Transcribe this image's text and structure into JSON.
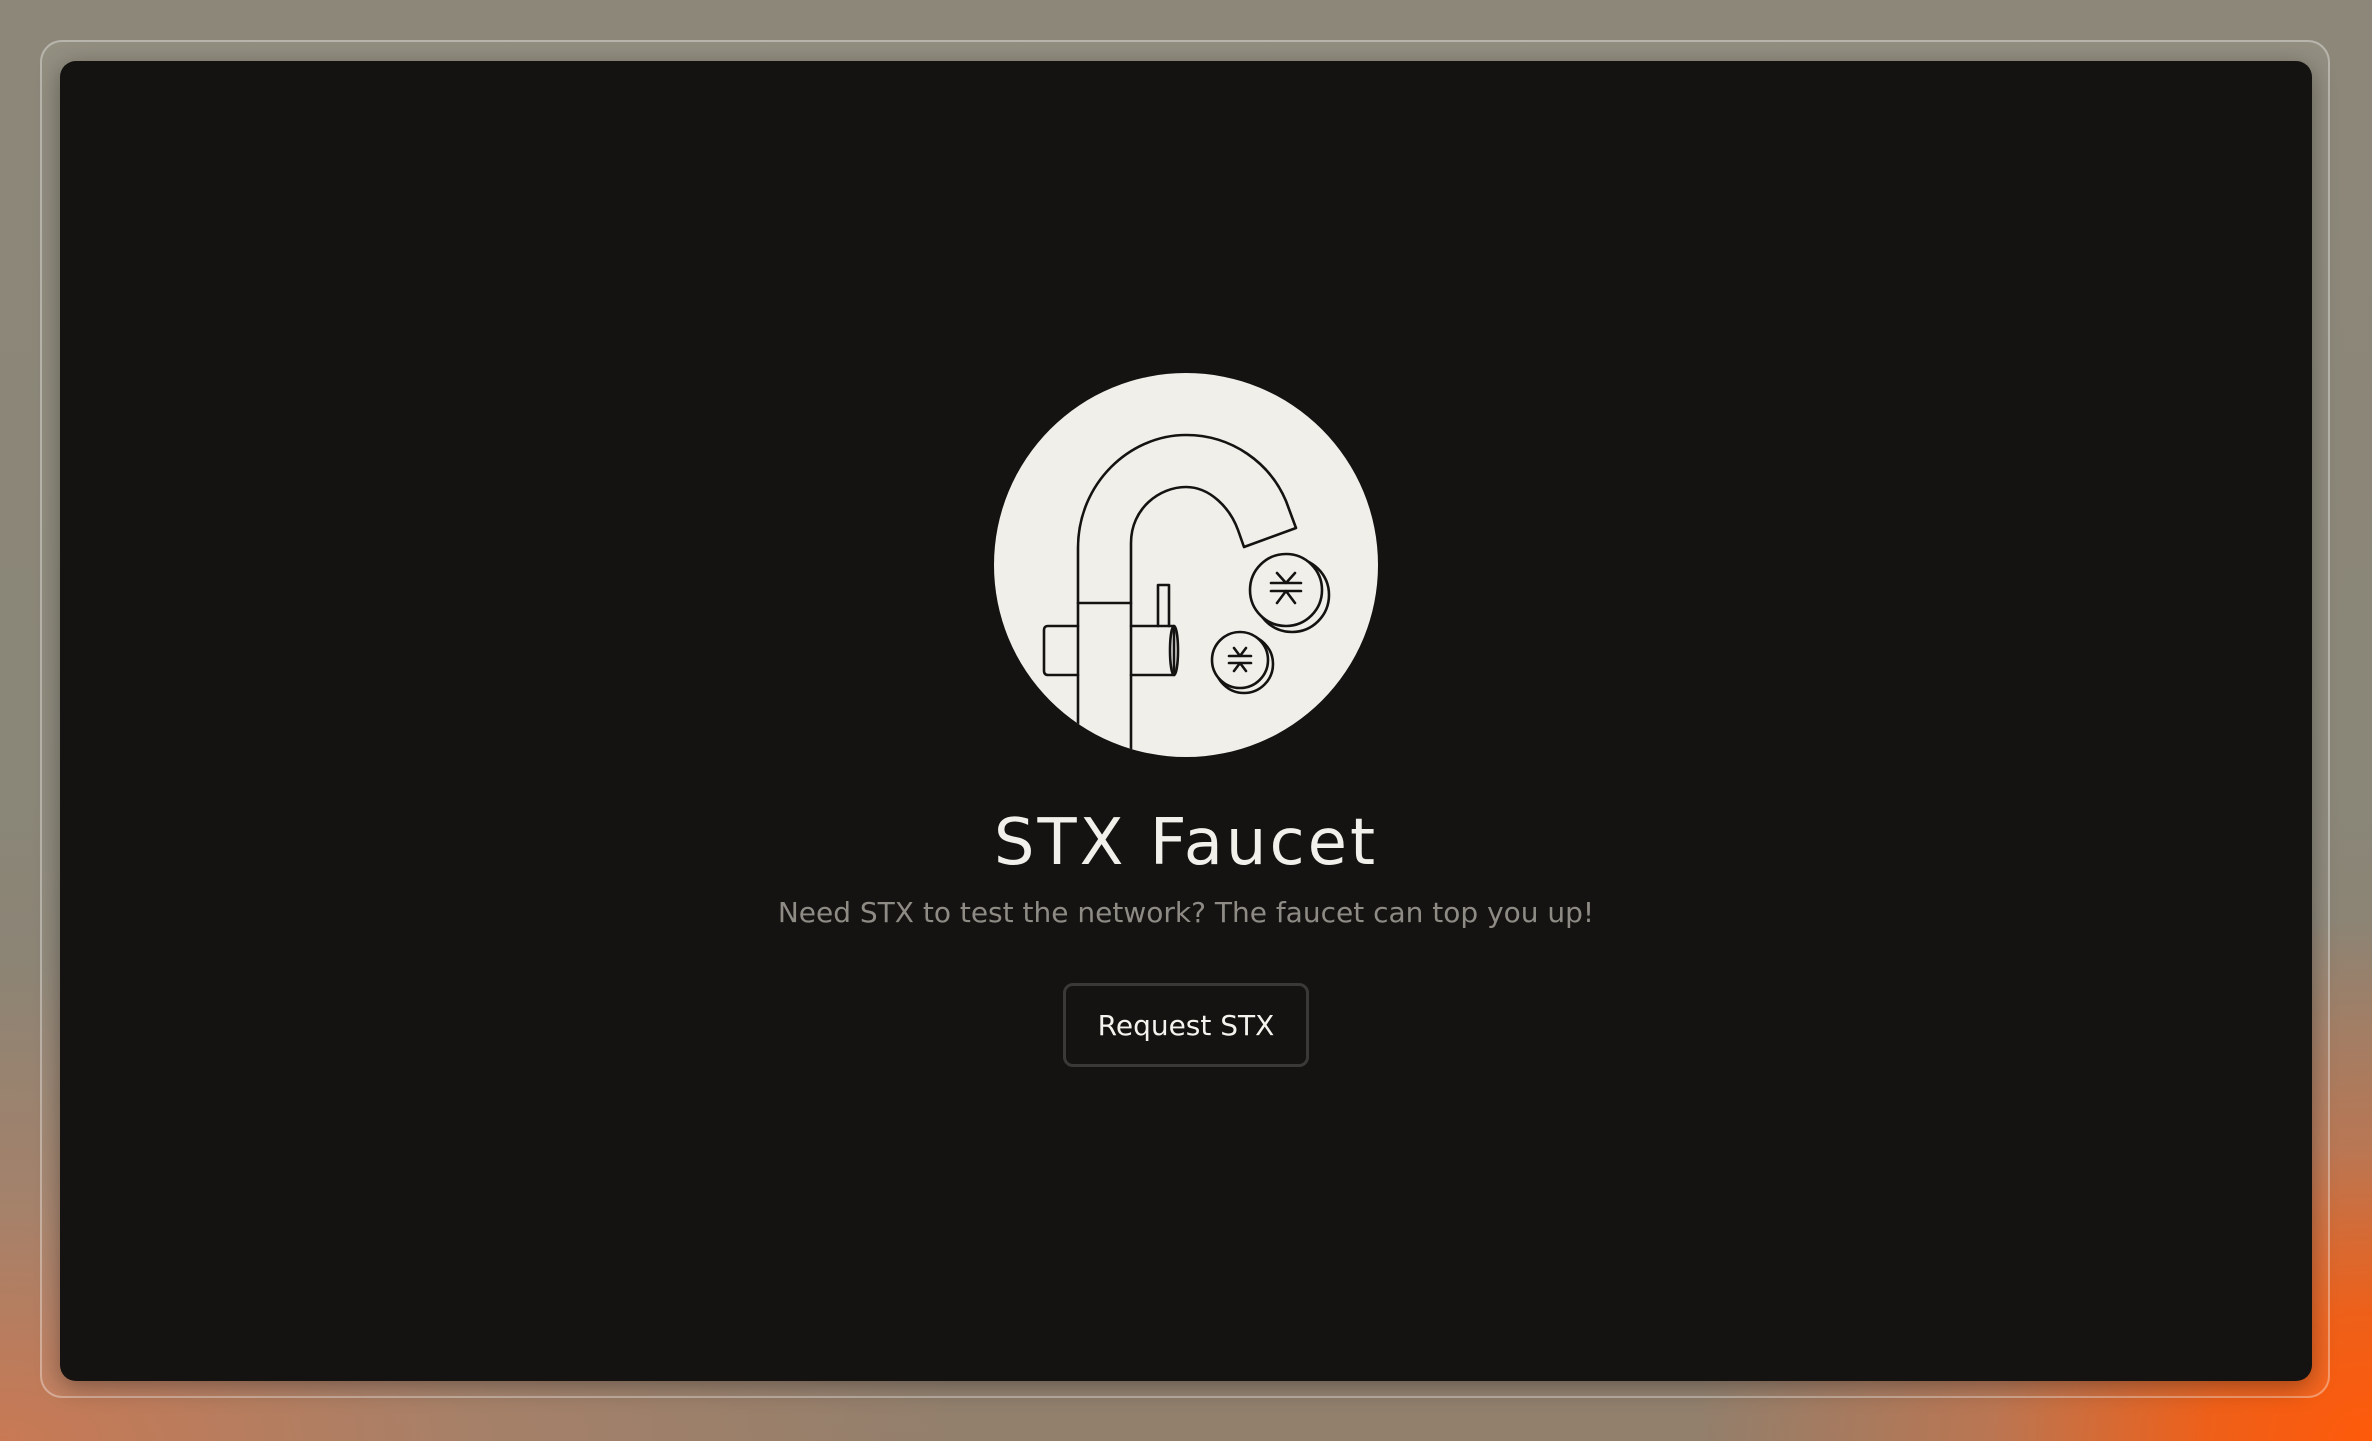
{
  "faucet": {
    "title": "STX Faucet",
    "description": "Need STX to test the network? The faucet can top you up!",
    "request_button_label": "Request STX",
    "illustration_icon": "faucet-with-coins-icon"
  },
  "colors": {
    "window_background": "#141312",
    "illustration_fill": "#f1efea",
    "title_text": "#f2f0ea",
    "description_text": "#8e8b85",
    "button_border": "#3a3937",
    "accent_orange": "#ff5a0a"
  }
}
